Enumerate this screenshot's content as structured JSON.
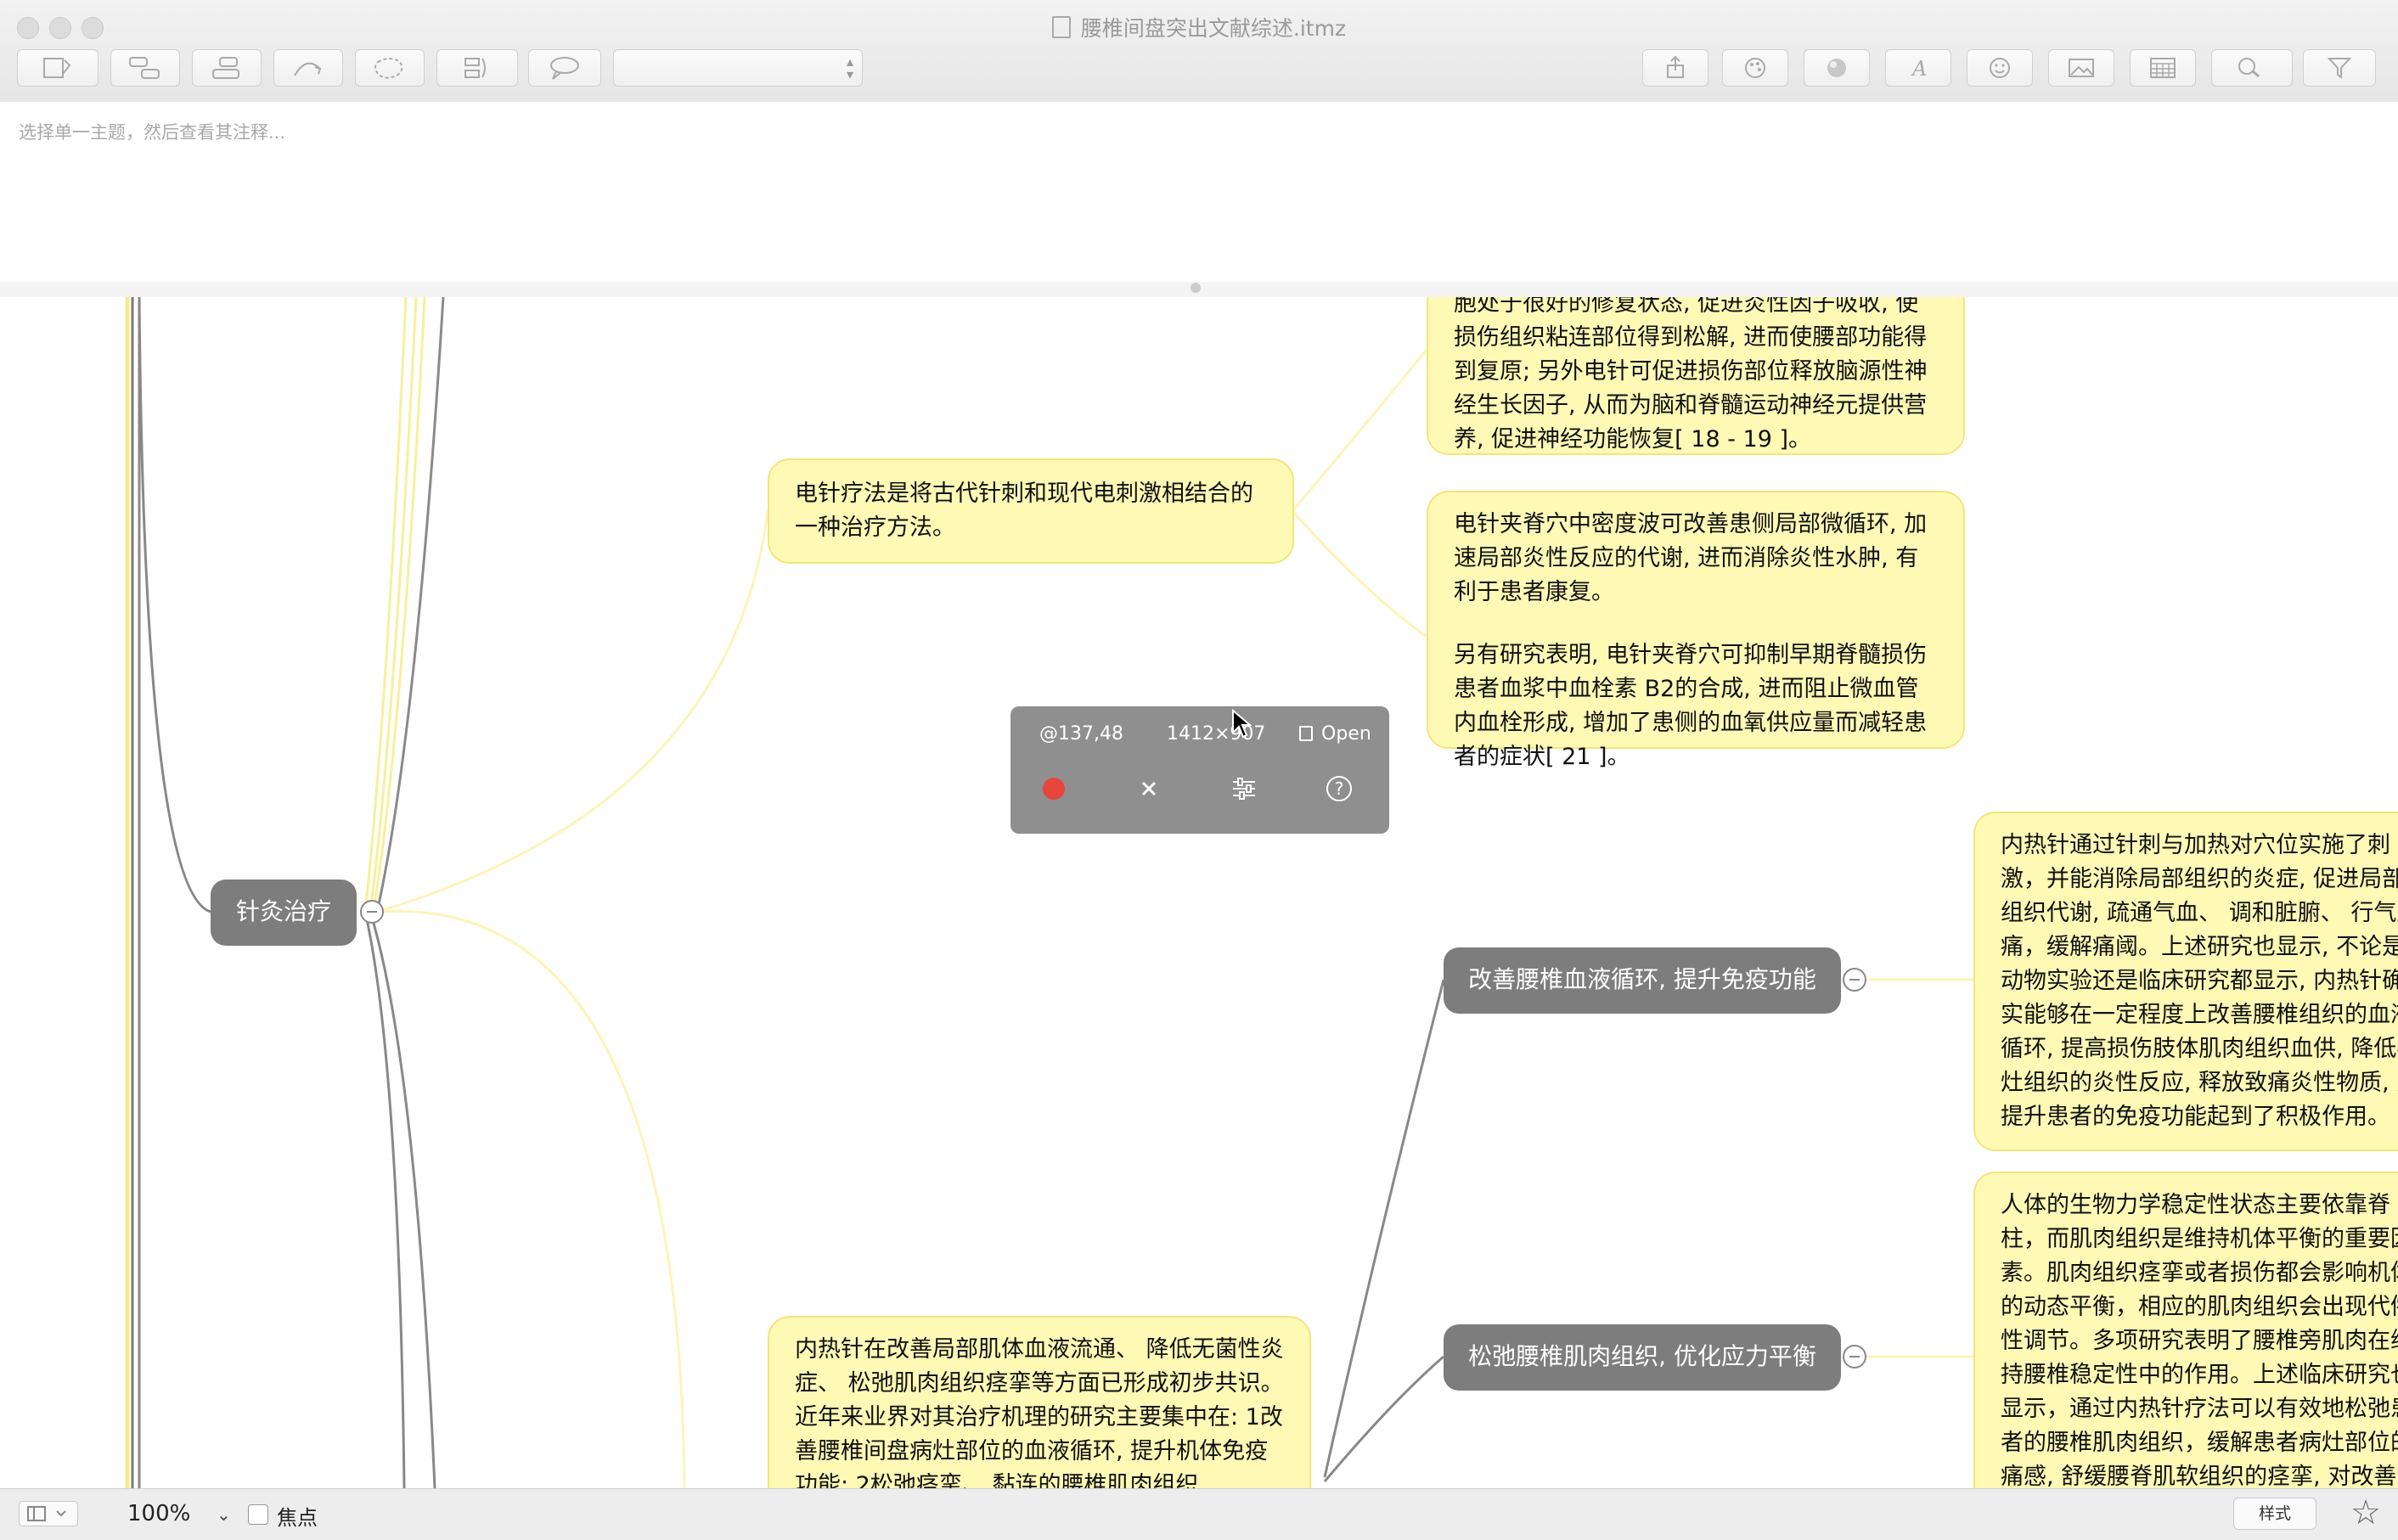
{
  "window": {
    "title": "腰椎间盘突出文献综述.itmz"
  },
  "notes": {
    "placeholder": "选择单一主题，然后查看其注释..."
  },
  "map": {
    "topics": {
      "acupuncture": "针灸治疗",
      "improve_circulation": "改善腰椎血液循环, 提升免疫功能",
      "relax_muscle": "松弛腰椎肌肉组织, 优化应力平衡"
    },
    "notes": {
      "electro_top": "胞处于很好的修复状态, 促进炎性因子吸收, 使损伤组织粘连部位得到松解, 进而使腰部功能得到复原; 另外电针可促进损伤部位释放脑源性神经生长因子, 从而为脑和脊髓运动神经元提供营养, 促进神经功能恢复[ 18 - 19 ]。",
      "electro_def": "电针疗法是将古代针刺和现代电刺激相结合的一种治疗方法。",
      "electro_spine_1": "电针夹脊穴中密度波可改善患侧局部微循环, 加速局部炎性反应的代谢, 进而消除炎性水肿, 有利于患者康复。",
      "electro_spine_2": "另有研究表明, 电针夹脊穴可抑制早期脊髓损伤患者血浆中血栓素 B2的合成, 进而阻止微血管内血栓形成, 增加了患侧的血氧供应量而减轻患者的症状[ 21 ]。",
      "inner_heat_right": "内热针通过针刺与加热对穴位实施了刺激，并能消除局部组织的炎症, 促进局部组织代谢, 疏通气血、 调和脏腑、 行气止痛，缓解痛阈。上述研究也显示, 不论是动物实验还是临床研究都显示, 内热针确实能够在一定程度上改善腰椎组织的血液循环, 提高损伤肢体肌肉组织血供, 降低病灶组织的炎性反应, 释放致痛炎性物质, 对提升患者的免疫功能起到了积极作用。",
      "biomech_right": "人体的生物力学稳定性状态主要依靠脊柱，而肌肉组织是维持机体平衡的重要因素。肌肉组织痉挛或者损伤都会影响机体的动态平衡，相应的肌肉组织会出现代偿性调节。多项研究表明了腰椎旁肌肉在维持腰椎稳定性中的作用。上述临床研究也显示，通过内热针疗法可以有效地松弛患者的腰椎肌肉组织，缓解患者病灶部位的痛感, 舒缓腰脊肌软组织的痉挛, 对改善患者的腰椎功能、 优化应力平衡。",
      "inner_heat_bottom": "内热针在改善局部肌体血液流通、 降低无菌性炎症、 松弛肌肉组织痉挛等方面已形成初步共识。近年来业界对其治疗机理的研究主要集中在: 1改善腰椎间盘病灶部位的血液循环, 提升机体免疫功能; 2松弛痉挛、 黏连的腰椎肌肉组织"
    }
  },
  "overlay": {
    "position": "@137,48",
    "size": "1412×907",
    "lock_label": "Open"
  },
  "statusbar": {
    "zoom": "100%",
    "focus_label": "焦点",
    "style_label": "样式"
  },
  "colors": {
    "note_fill": "#fff9b6",
    "note_border": "#f2e57a",
    "topic_fill": "#7d7d7d",
    "record": "#e8453c"
  }
}
